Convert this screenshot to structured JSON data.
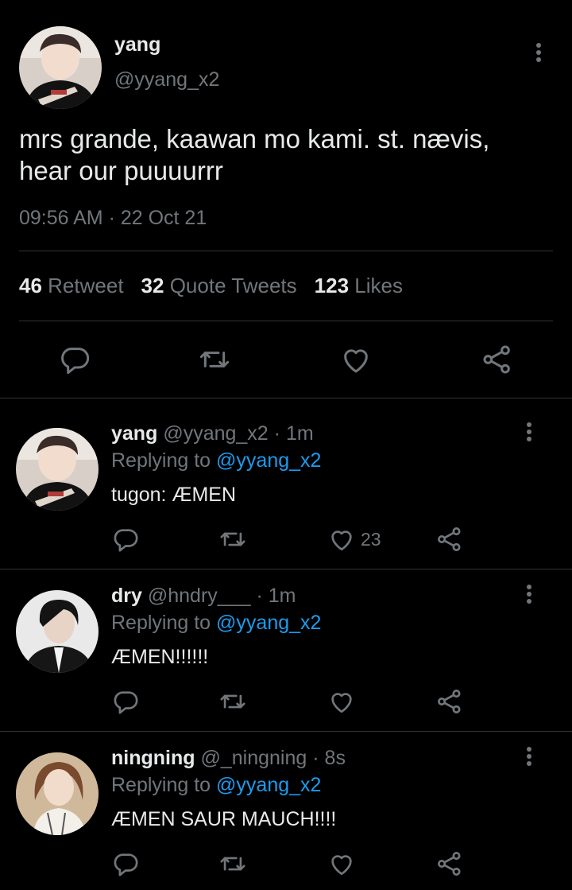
{
  "main_tweet": {
    "author_name": "yang",
    "author_handle": "@yyang_x2",
    "text": "mrs grande, kaawan mo kami. st. nævis, hear our puuuurrr",
    "timestamp": "09:56 AM · 22 Oct 21",
    "stats": {
      "retweets_count": "46",
      "retweets_label": "Retweet",
      "quotes_count": "32",
      "quotes_label": "Quote Tweets",
      "likes_count": "123",
      "likes_label": "Likes"
    },
    "icons": [
      "reply-icon",
      "retweet-icon",
      "like-icon",
      "share-icon"
    ]
  },
  "replies": [
    {
      "name": "yang",
      "handle": "@yyang_x2",
      "time": "· 1m",
      "replying_prefix": "Replying to",
      "replying_to": "@yyang_x2",
      "text": "tugon: ÆMEN",
      "like_count": "23"
    },
    {
      "name": "dry",
      "handle": "@hndry___",
      "time": "· 1m",
      "replying_prefix": "Replying to",
      "replying_to": "@yyang_x2",
      "text": "ÆMEN!!!!!!",
      "like_count": ""
    },
    {
      "name": "ningning",
      "handle": "@_ningning",
      "time": "· 8s",
      "replying_prefix": "Replying to",
      "replying_to": "@yyang_x2",
      "text": "ÆMEN SAUR MAUCH!!!!",
      "like_count": ""
    }
  ],
  "colors": {
    "background": "#000000",
    "text_primary": "#e7e9ea",
    "text_secondary": "#71767b",
    "link": "#1d9bf0",
    "divider": "#2f3336"
  }
}
